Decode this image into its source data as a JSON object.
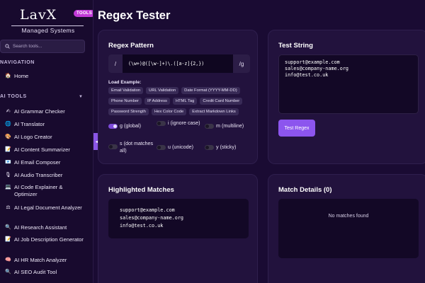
{
  "brand": {
    "name": "LavX",
    "badge": "TOOLS",
    "subtitle": "Managed Systems"
  },
  "search": {
    "placeholder": "Search tools..."
  },
  "sidebar": {
    "navigation_heading": "NAVIGATION",
    "home": {
      "label": "Home",
      "icon": "house-icon"
    },
    "tools_heading": "AI TOOLS",
    "tools": [
      {
        "label": "AI Grammar Checker",
        "icon": "pencil-icon"
      },
      {
        "label": "AI Translator",
        "icon": "globe-icon"
      },
      {
        "label": "AI Logo Creator",
        "icon": "palette-icon"
      },
      {
        "label": "AI Content Summarizer",
        "icon": "memo-icon"
      },
      {
        "label": "AI Email Composer",
        "icon": "email-icon"
      },
      {
        "label": "AI Audio Transcriber",
        "icon": "microphone-icon"
      },
      {
        "label": "AI Code Explainer & Optimizer",
        "icon": "laptop-icon"
      },
      {
        "label": "AI Legal Document Analyzer",
        "icon": "scales-icon"
      },
      {
        "label": "AI Research Assistant",
        "icon": "magnifier-icon"
      },
      {
        "label": "AI Job Description Generator",
        "icon": "memo-icon"
      },
      {
        "label": "AI HR Match Analyzer",
        "icon": "brain-icon"
      },
      {
        "label": "AI SEO Audit Tool",
        "icon": "magnifier-icon"
      }
    ]
  },
  "page": {
    "title": "Regex Tester"
  },
  "regex_pattern": {
    "title": "Regex Pattern",
    "open_slash": "/",
    "value": "(\\w+)@([\\w-]+)\\.([a-z]{2,})",
    "flags": "/g",
    "load_label": "Load Example:",
    "examples": [
      "Email Validation",
      "URL Validation",
      "Date Format (YYYY-MM-DD)",
      "Phone Number",
      "IP Address",
      "HTML Tag",
      "Credit Card Number",
      "Password Strength",
      "Hex Color Code",
      "Extract Markdown Links"
    ],
    "flag_options": [
      {
        "label": "g (global)",
        "on": true
      },
      {
        "label": "i (ignore case)",
        "on": false
      },
      {
        "label": "m (multiline)",
        "on": false
      },
      {
        "label": "s (dot matches all)",
        "on": false
      },
      {
        "label": "u (unicode)",
        "on": false
      },
      {
        "label": "y (sticky)",
        "on": false
      }
    ]
  },
  "test_string": {
    "title": "Test String",
    "value": "support@example.com\nsales@company-name.org\ninfo@test.co.uk",
    "button": "Test Regex"
  },
  "highlighted": {
    "title": "Highlighted Matches",
    "lines": [
      "support@example.com",
      "sales@company-name.org",
      "info@test.co.uk"
    ]
  },
  "details": {
    "title": "Match Details (0)",
    "empty": "No matches found"
  },
  "colors": {
    "accent": "#8c55ee",
    "badge": "#c23ad8",
    "background": "#1a0b33",
    "card": "#22123d"
  }
}
